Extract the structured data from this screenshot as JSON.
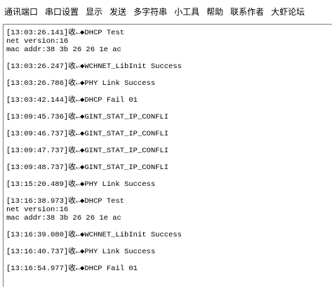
{
  "menu": {
    "items": [
      "通讯端口",
      "串口设置",
      "显示",
      "发送",
      "多字符串",
      "小工具",
      "帮助",
      "联系作者",
      "大虾论坛"
    ]
  },
  "log": {
    "text": "[13:03:26.141]收←◆DHCP Test\nnet version:16\nmac addr:38 3b 26 26 1e ac\n\n[13:03:26.247]收←◆WCHNET_LibInit Success\n\n[13:03:26.786]收←◆PHY Link Success\n\n[13:03:42.144]收←◆DHCP Fail 01\n\n[13:09:45.736]收←◆GINT_STAT_IP_CONFLI\n\n[13:09:46.737]收←◆GINT_STAT_IP_CONFLI\n\n[13:09:47.737]收←◆GINT_STAT_IP_CONFLI\n\n[13:09:48.737]收←◆GINT_STAT_IP_CONFLI\n\n[13:15:20.489]收←◆PHY Link Success\n\n[13:16:38.973]收←◆DHCP Test\nnet version:16\nmac addr:38 3b 26 26 1e ac\n\n[13:16:39.080]收←◆WCHNET_LibInit Success\n\n[13:16:40.737]收←◆PHY Link Success\n\n[13:16:54.977]收←◆DHCP Fail 01"
  }
}
